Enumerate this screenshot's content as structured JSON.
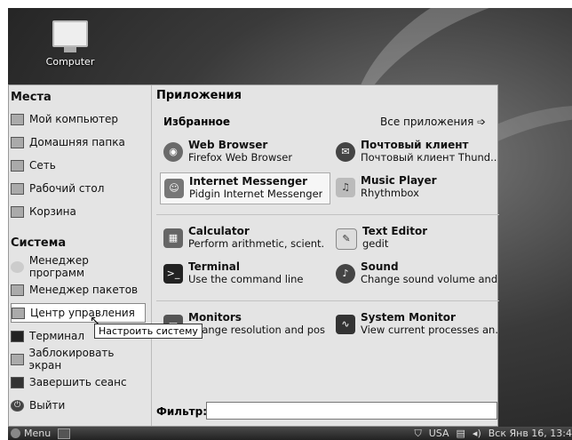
{
  "desktop": {
    "icon_label": "Computer"
  },
  "left": {
    "places_title": "Места",
    "places": [
      {
        "label": "Мой компьютер",
        "icon": "computer-icon"
      },
      {
        "label": "Домашняя папка",
        "icon": "folder-icon"
      },
      {
        "label": "Сеть",
        "icon": "network-icon"
      },
      {
        "label": "Рабочий стол",
        "icon": "desktop-icon"
      },
      {
        "label": "Корзина",
        "icon": "trash-icon"
      }
    ],
    "system_title": "Система",
    "system": [
      {
        "label": "Менеджер программ",
        "icon": "software-manager-icon"
      },
      {
        "label": "Менеджер пакетов",
        "icon": "package-manager-icon"
      },
      {
        "label": "Центр управления",
        "icon": "control-center-icon"
      },
      {
        "label": "Терминал",
        "icon": "terminal-icon"
      },
      {
        "label": "Заблокировать экран",
        "icon": "lock-icon"
      },
      {
        "label": "Завершить сеанс",
        "icon": "logout-icon"
      },
      {
        "label": "Выйти",
        "icon": "power-icon"
      }
    ],
    "tooltip": "Настроить систему"
  },
  "right": {
    "apps_title": "Приложения",
    "favorites_title": "Избранное",
    "all_apps": "Все приложения ➩",
    "apps": [
      {
        "name": "Web Browser",
        "desc": "Firefox Web Browser",
        "icon": "firefox-icon"
      },
      {
        "name": "Почтовый клиент",
        "desc": "Почтовый клиент Thund...",
        "icon": "mail-icon"
      },
      {
        "name": "Internet Messenger",
        "desc": "Pidgin Internet Messenger",
        "icon": "pidgin-icon"
      },
      {
        "name": "Music Player",
        "desc": "Rhythmbox",
        "icon": "music-icon"
      },
      {
        "name": "Calculator",
        "desc": "Perform arithmetic, scient...",
        "icon": "calculator-icon"
      },
      {
        "name": "Text Editor",
        "desc": "gedit",
        "icon": "text-editor-icon"
      },
      {
        "name": "Terminal",
        "desc": "Use the command line",
        "icon": "terminal-icon"
      },
      {
        "name": "Sound",
        "desc": "Change sound volume and...",
        "icon": "sound-icon"
      },
      {
        "name": "Monitors",
        "desc": "Change resolution and pos...",
        "icon": "monitor-icon"
      },
      {
        "name": "System Monitor",
        "desc": "View current processes an...",
        "icon": "system-monitor-icon"
      }
    ],
    "filter_label": "Фильтр:",
    "filter_value": ""
  },
  "panel": {
    "menu_label": "Menu",
    "keyboard": "USA",
    "clock": "Вск Янв 16, 13:4"
  }
}
